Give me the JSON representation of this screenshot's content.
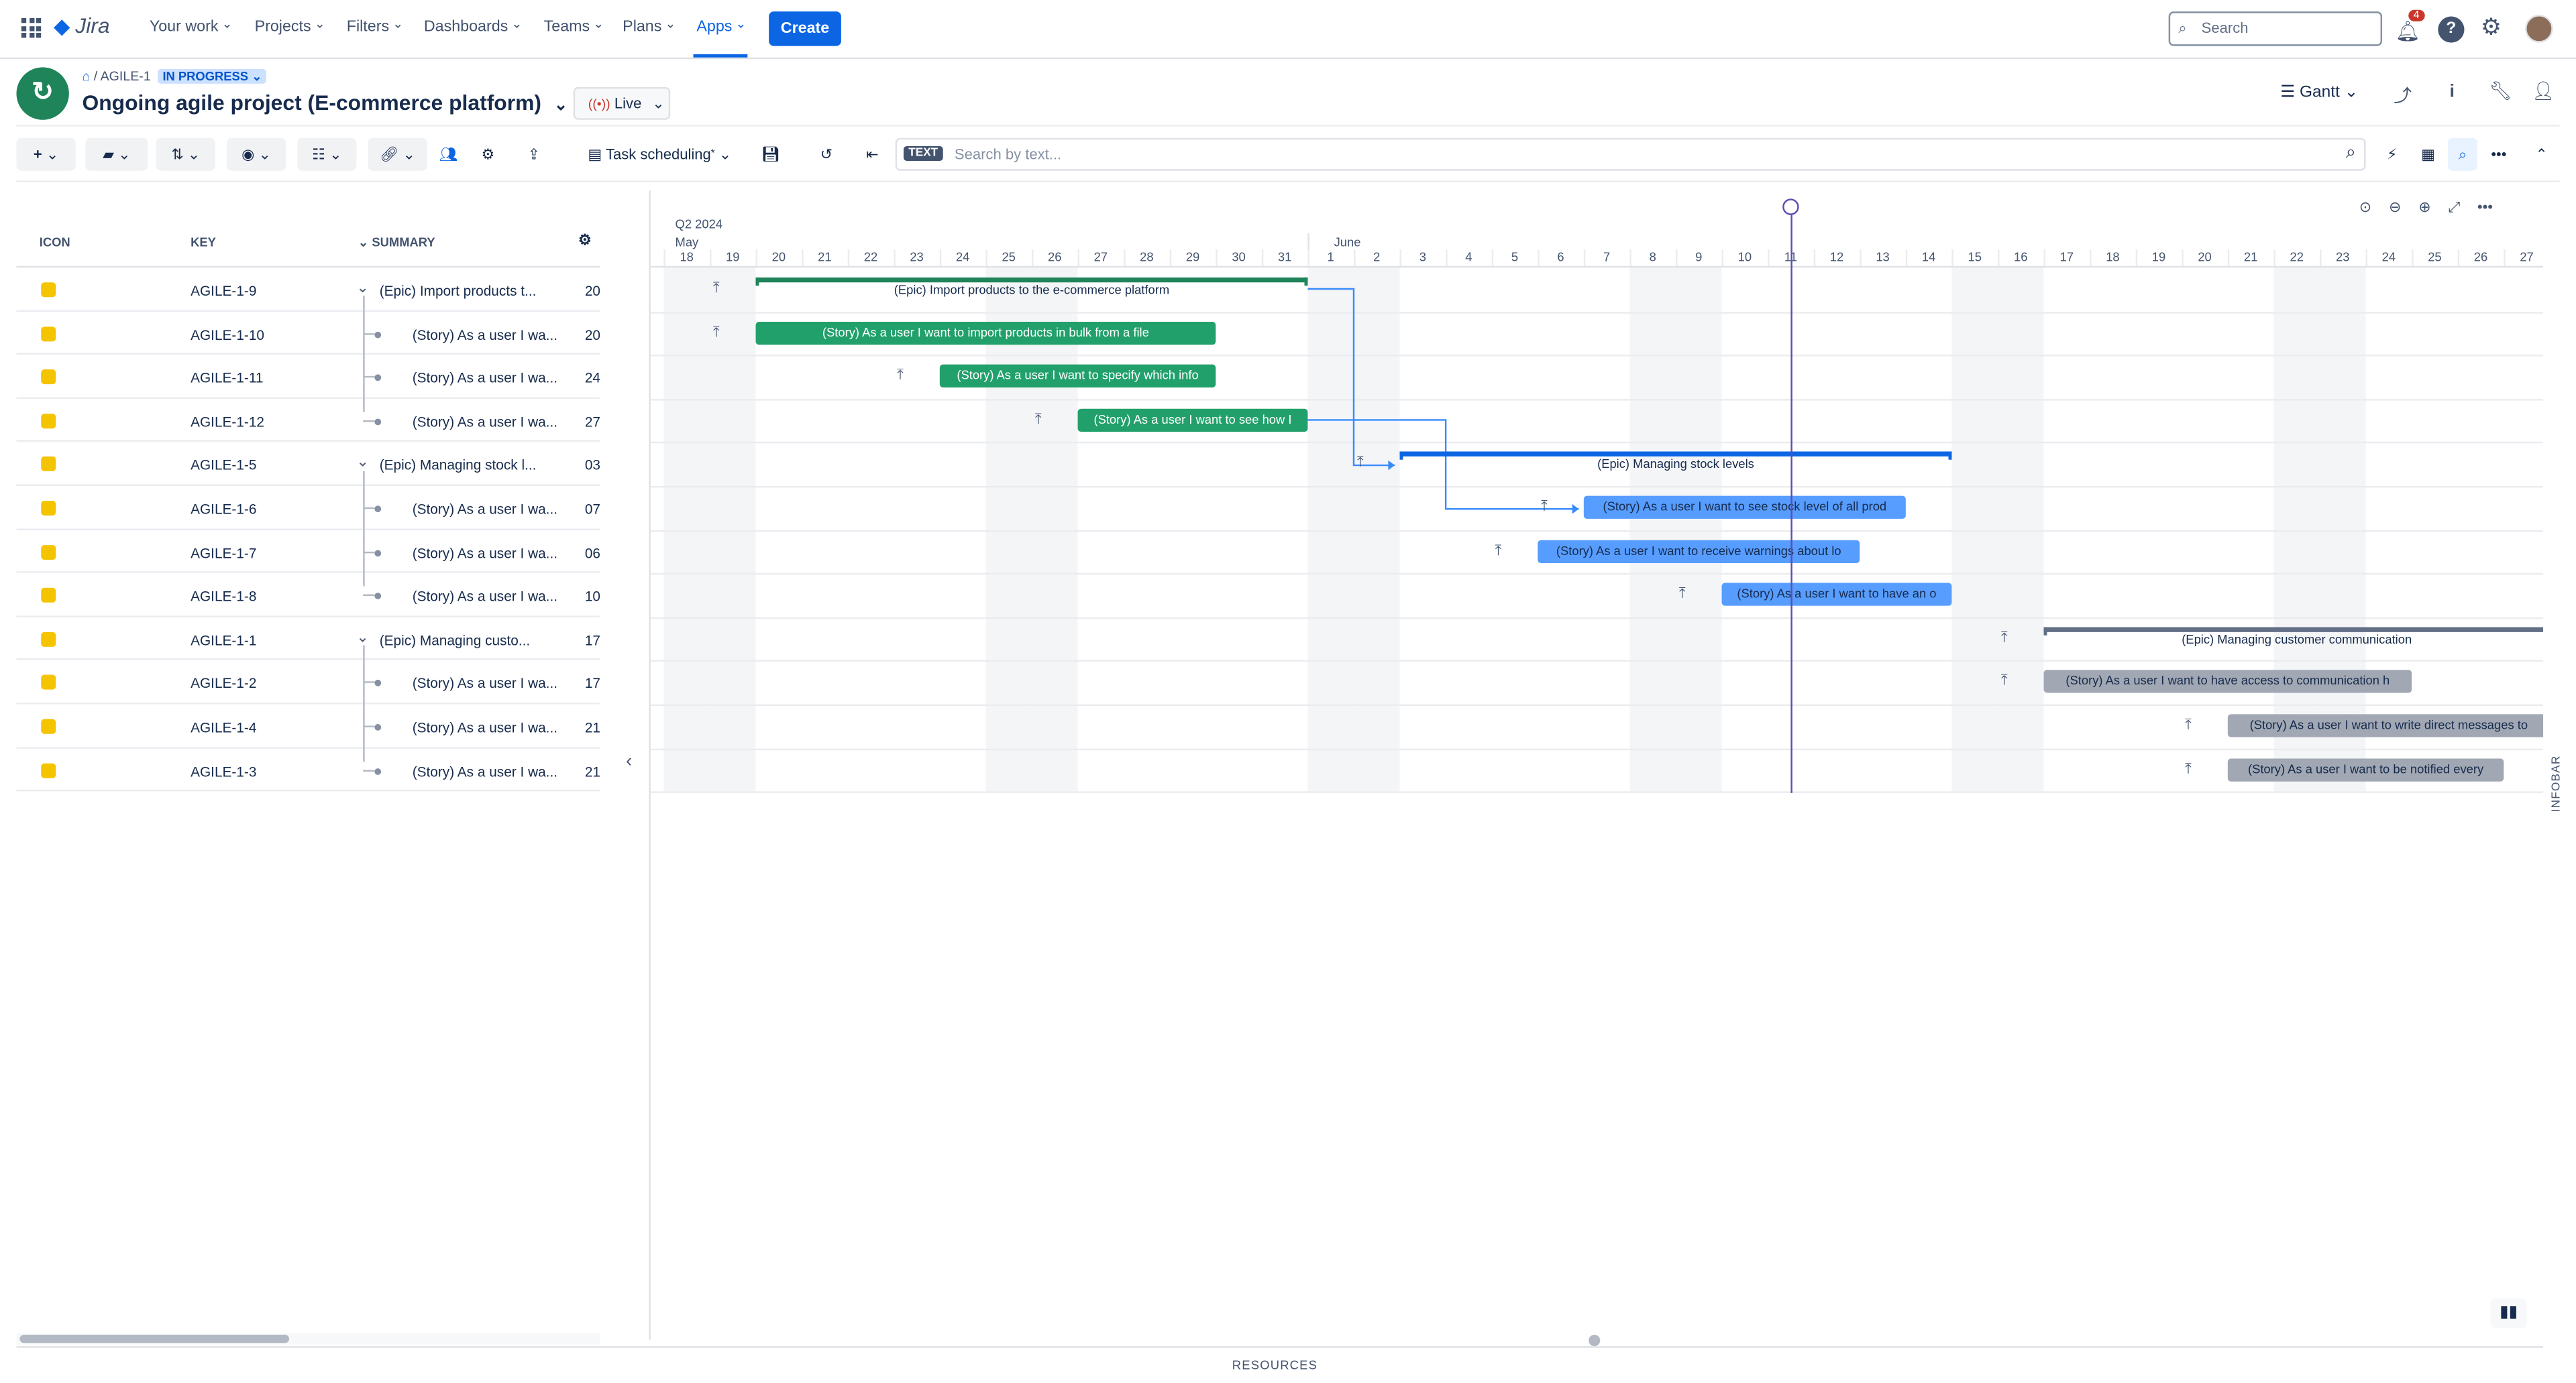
{
  "nav": {
    "logo": "Jira",
    "items": [
      "Your work",
      "Projects",
      "Filters",
      "Dashboards",
      "Teams",
      "Plans",
      "Apps"
    ],
    "active": "Apps",
    "create": "Create",
    "search_placeholder": "Search",
    "notifications_count": "4"
  },
  "project": {
    "breadcrumb_key": "AGILE-1",
    "status": "IN PROGRESS",
    "title": "Ongoing agile project (E-commerce platform)",
    "mode": "Live",
    "view": "Gantt"
  },
  "toolbar": {
    "scheduling": "Task scheduling",
    "text_badge": "TEXT",
    "search_placeholder": "Search by text..."
  },
  "grid": {
    "headers": {
      "icon": "ICON",
      "key": "KEY",
      "summary": "SUMMARY"
    },
    "rows": [
      {
        "key": "AGILE-1-9",
        "summary": "(Epic) Import products t...",
        "start": "20",
        "epic": true
      },
      {
        "key": "AGILE-1-10",
        "summary": "(Story) As a user I wa...",
        "start": "20",
        "epic": false
      },
      {
        "key": "AGILE-1-11",
        "summary": "(Story) As a user I wa...",
        "start": "24",
        "epic": false
      },
      {
        "key": "AGILE-1-12",
        "summary": "(Story) As a user I wa...",
        "start": "27",
        "epic": false
      },
      {
        "key": "AGILE-1-5",
        "summary": "(Epic) Managing stock l...",
        "start": "03",
        "epic": true
      },
      {
        "key": "AGILE-1-6",
        "summary": "(Story) As a user I wa...",
        "start": "07",
        "epic": false
      },
      {
        "key": "AGILE-1-7",
        "summary": "(Story) As a user I wa...",
        "start": "06",
        "epic": false
      },
      {
        "key": "AGILE-1-8",
        "summary": "(Story) As a user I wa...",
        "start": "10",
        "epic": false
      },
      {
        "key": "AGILE-1-1",
        "summary": "(Epic) Managing custo...",
        "start": "17",
        "epic": true
      },
      {
        "key": "AGILE-1-2",
        "summary": "(Story) As a user I wa...",
        "start": "17",
        "epic": false
      },
      {
        "key": "AGILE-1-4",
        "summary": "(Story) As a user I wa...",
        "start": "21",
        "epic": false
      },
      {
        "key": "AGILE-1-3",
        "summary": "(Story) As a user I wa...",
        "start": "21",
        "epic": false
      }
    ]
  },
  "timeline": {
    "quarter": "Q2 2024",
    "months": [
      "May",
      "June"
    ],
    "days": [
      "18",
      "19",
      "20",
      "21",
      "22",
      "23",
      "24",
      "25",
      "26",
      "27",
      "28",
      "29",
      "30",
      "31",
      "1",
      "2",
      "3",
      "4",
      "5",
      "6",
      "7",
      "8",
      "9",
      "10",
      "11",
      "12",
      "13",
      "14",
      "15",
      "16",
      "17",
      "18",
      "19",
      "20",
      "21",
      "22",
      "23",
      "24",
      "25",
      "26",
      "27"
    ],
    "weekends": [
      0,
      1,
      7,
      8,
      14,
      15,
      21,
      22,
      28,
      29,
      35,
      36
    ],
    "today_index": 24,
    "tasks": [
      {
        "row": 0,
        "type": "epic",
        "color": "#1f845a",
        "start": 2,
        "end": 14,
        "label": "(Epic) Import products to the e-commerce platform"
      },
      {
        "row": 1,
        "type": "story",
        "color": "#22a06b",
        "start": 2,
        "end": 12,
        "label": "(Story) As a user I want to import products in bulk from a file"
      },
      {
        "row": 2,
        "type": "story",
        "color": "#22a06b",
        "start": 6,
        "end": 12,
        "label": "(Story) As a user I want to specify which info"
      },
      {
        "row": 3,
        "type": "story",
        "color": "#22a06b",
        "start": 9,
        "end": 14,
        "label": "(Story) As a user I want to see how I"
      },
      {
        "row": 4,
        "type": "epic",
        "color": "#0c66e4",
        "start": 16,
        "end": 28,
        "label": "(Epic) Managing stock levels"
      },
      {
        "row": 5,
        "type": "story",
        "color": "#579dff",
        "start": 20,
        "end": 27,
        "label": "(Story) As a user I want to see stock level of all prod"
      },
      {
        "row": 6,
        "type": "story",
        "color": "#579dff",
        "start": 19,
        "end": 26,
        "label": "(Story) As a user I want to receive warnings about lo"
      },
      {
        "row": 7,
        "type": "story",
        "color": "#579dff",
        "start": 23,
        "end": 28,
        "label": "(Story) As a user I want to have an o"
      },
      {
        "row": 8,
        "type": "epic",
        "color": "#626f86",
        "start": 30,
        "end": 41,
        "label": "(Epic) Managing customer communication"
      },
      {
        "row": 9,
        "type": "story",
        "color": "#a1a8b3",
        "start": 30,
        "end": 38,
        "label": "(Story) As a user I want to have access to communication h"
      },
      {
        "row": 10,
        "type": "story",
        "color": "#a1a8b3",
        "start": 34,
        "end": 41,
        "label": "(Story) As a user I want to write direct messages to"
      },
      {
        "row": 11,
        "type": "story",
        "color": "#a1a8b3",
        "start": 34,
        "end": 40,
        "label": "(Story) As a user I want to be notified every"
      }
    ]
  },
  "footer": {
    "resources": "RESOURCES",
    "infobar": "INFOBAR"
  }
}
